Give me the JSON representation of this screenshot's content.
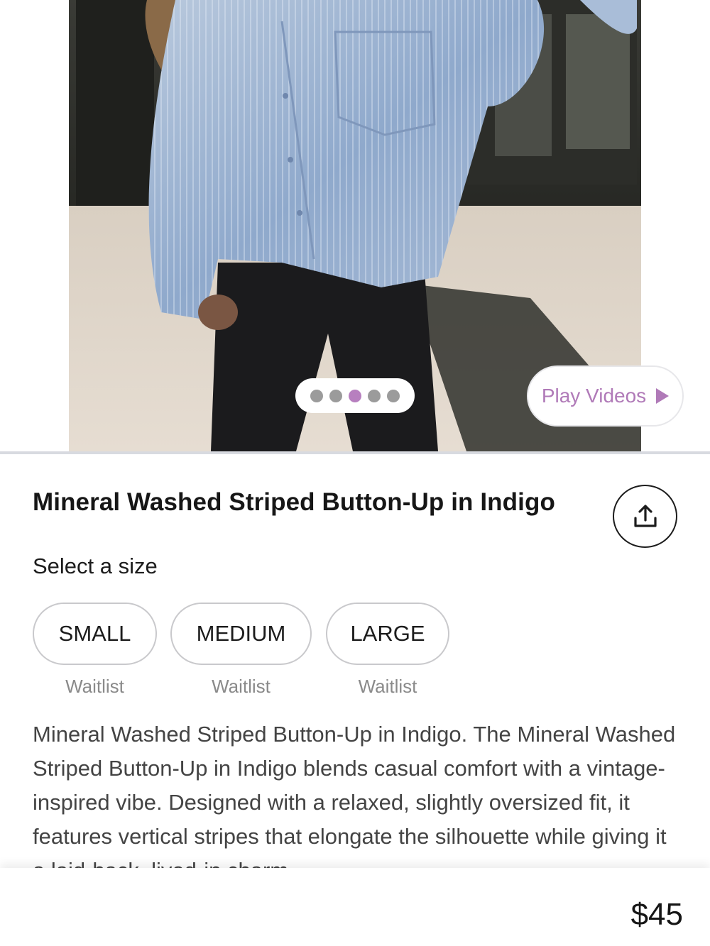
{
  "gallery": {
    "image_alt": "Model wearing a mineral washed striped button-up shirt in indigo with black jeans",
    "dots": [
      {
        "active": false
      },
      {
        "active": false
      },
      {
        "active": true
      },
      {
        "active": false
      },
      {
        "active": false
      }
    ],
    "play_videos_label": "Play Videos"
  },
  "product": {
    "title": "Mineral Washed Striped Button-Up in Indigo",
    "share_icon": "share-upload-icon",
    "select_size_label": "Select a size",
    "sizes": [
      {
        "label": "SMALL",
        "status": "Waitlist"
      },
      {
        "label": "MEDIUM",
        "status": "Waitlist"
      },
      {
        "label": "LARGE",
        "status": "Waitlist"
      }
    ],
    "description": "Mineral Washed Striped Button-Up in Indigo. The Mineral Washed Striped Button-Up in Indigo blends casual comfort with a vintage-inspired vibe. Designed with a relaxed, slightly oversized fit, it features vertical stripes that elongate the silhouette while giving it a laid-back, lived-in charm."
  },
  "footer": {
    "price": "$45"
  },
  "colors": {
    "accent": "#b77fbf",
    "dot_inactive": "#9b9b9b",
    "text": "#1c1c1c",
    "muted": "#8a8a8a"
  }
}
